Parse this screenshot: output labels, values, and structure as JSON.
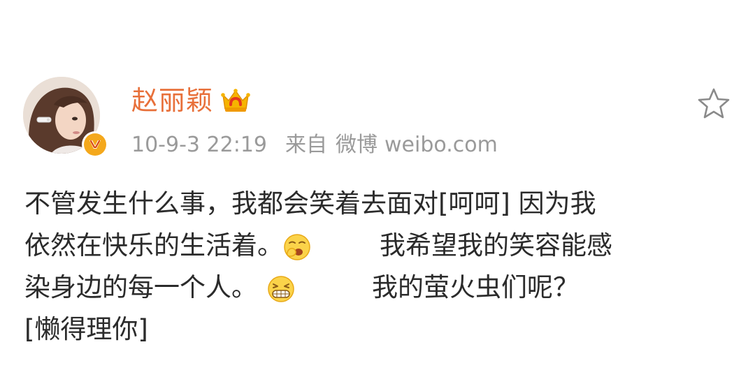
{
  "post": {
    "author": {
      "name": "赵丽颖",
      "badge_icon": "crown-icon",
      "verified_icon": "verified-v-icon"
    },
    "meta": {
      "time": "10-9-3 22:19",
      "from_label": "来自",
      "app_name": "微博",
      "domain": "weibo.com"
    },
    "favorite_icon": "star-outline-icon",
    "content": {
      "line1": "不管发生什么事，我都会笑着去面对[呵呵] 因为我",
      "line2_a": "依然在快乐的生活着。",
      "line2_b": "我希望我的笑容能感",
      "line3_a": "染身边的每一个人。",
      "line3_b": "我的萤火虫们呢？",
      "line4": "[懒得理你]"
    },
    "emoji": [
      "yawn-emoji-icon",
      "grin-emoji-icon"
    ],
    "colors": {
      "author_name": "#e8703a",
      "meta_text": "#9a9a9a",
      "body_text": "#2b2b2b",
      "verified_badge": "#f4a81c"
    }
  }
}
